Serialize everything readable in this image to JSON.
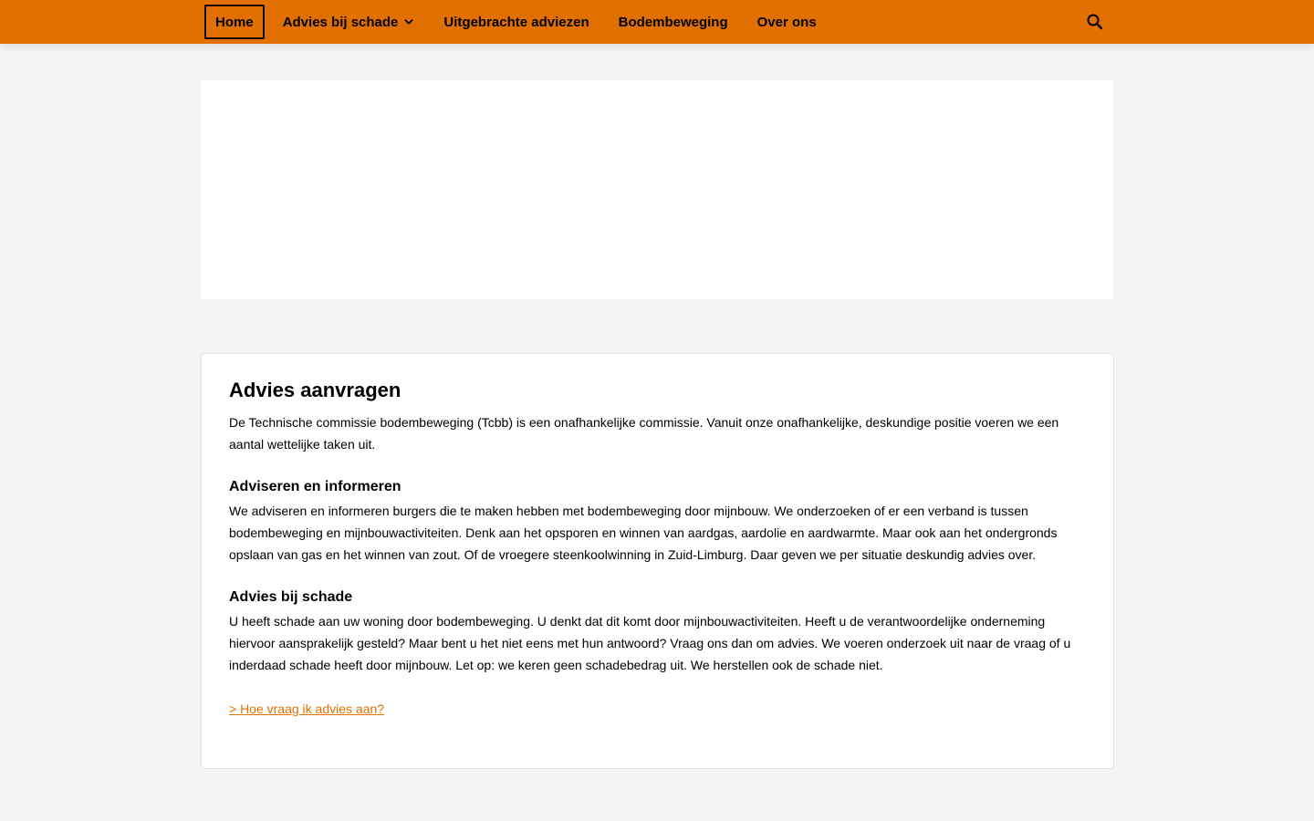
{
  "nav": {
    "items": [
      {
        "label": "Home",
        "active": true
      },
      {
        "label": "Advies bij schade",
        "has_dropdown": true
      },
      {
        "label": "Uitgebrachte adviezen"
      },
      {
        "label": "Bodembeweging"
      },
      {
        "label": "Over ons"
      }
    ],
    "search_icon": "search-icon",
    "dropdown_icon": "chevron-down-icon"
  },
  "colors": {
    "brand": "#e17000",
    "background": "#f4f4f4",
    "card": "#ffffff",
    "link": "#e17000"
  },
  "content": {
    "title": "Advies aanvragen",
    "intro": "De Technische commissie bodembeweging (Tcbb) is een onafhankelijke  commissie. Vanuit onze onafhankelijke, deskundige positie voeren we een  aantal wettelijke taken uit.",
    "sections": [
      {
        "heading": "Adviseren en informeren",
        "text": "We adviseren en informeren burgers die te maken hebben met bodembeweging  door mijnbouw. We onderzoeken of er een verband is tussen bodembeweging  en mijnbouwactiviteiten. Denk aan het opsporen en winnen van aardgas,  aardolie en aardwarmte. Maar ook aan het ondergronds opslaan van gas en  het winnen van zout. Of de vroegere steenkoolwinning in Zuid-Limburg.  Daar geven we per situatie deskundig advies over."
      },
      {
        "heading": "Advies bij schade",
        "text": "U heeft  schade aan uw woning door bodembeweging. U denkt dat dit komt door  mijnbouwactiviteiten. Heeft u de verantwoordelijke onderneming hiervoor  aansprakelijk gesteld? Maar bent u het niet eens met hun antwoord? Vraag  ons dan om advies. We voeren onderzoek uit naar de vraag of u inderdaad  schade heeft door mijnbouw. Let op: we keren geen schadebedrag uit. We  herstellen ook de schade niet."
      }
    ],
    "link_text": "> Hoe vraag ik advies aan?"
  }
}
